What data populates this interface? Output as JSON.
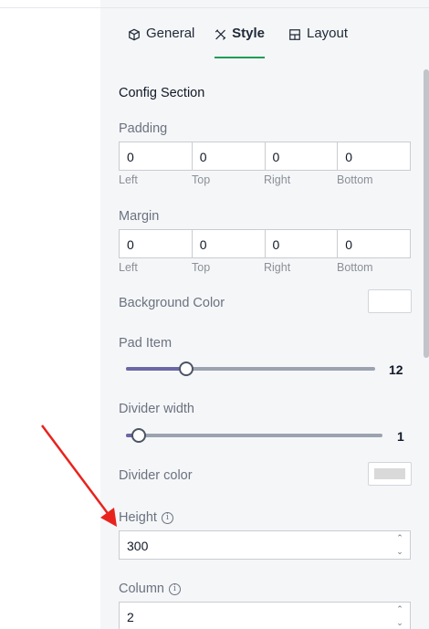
{
  "tabs": [
    {
      "label": "General",
      "icon": "cube-icon",
      "active": false
    },
    {
      "label": "Style",
      "icon": "tools-icon",
      "active": true
    },
    {
      "label": "Layout",
      "icon": "layout-icon",
      "active": false
    }
  ],
  "section_title": "Config Section",
  "padding": {
    "label": "Padding",
    "values": [
      "0",
      "0",
      "0",
      "0"
    ],
    "sides": [
      "Left",
      "Top",
      "Right",
      "Bottom"
    ]
  },
  "margin": {
    "label": "Margin",
    "values": [
      "0",
      "0",
      "0",
      "0"
    ],
    "sides": [
      "Left",
      "Top",
      "Right",
      "Bottom"
    ]
  },
  "background_color": {
    "label": "Background Color",
    "value": "#ffffff"
  },
  "pad_item": {
    "label": "Pad Item",
    "value": "12",
    "fraction": 0.24
  },
  "divider_width": {
    "label": "Divider width",
    "value": "1",
    "fraction": 0.05
  },
  "divider_color": {
    "label": "Divider color",
    "value": "#d9d9d9"
  },
  "height": {
    "label": "Height",
    "value": "300"
  },
  "column": {
    "label": "Column",
    "value": "2"
  },
  "colors": {
    "accent": "#1f9d55",
    "slider_fill": "#6b67a6",
    "annotation": "#e8231e"
  }
}
